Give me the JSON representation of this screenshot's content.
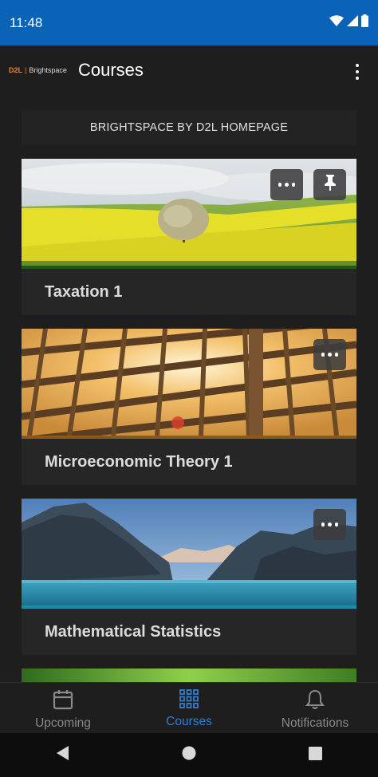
{
  "status_bar": {
    "time": "11:48"
  },
  "app_bar": {
    "logo_brand": "D2L",
    "logo_product": "Brightspace",
    "title": "Courses"
  },
  "homepage_label": "BRIGHTSPACE BY D2L HOMEPAGE",
  "courses": [
    {
      "name": "Taxation 1",
      "pinned": true,
      "stripe_color": "#1f5a10"
    },
    {
      "name": "Microeconomic Theory 1",
      "pinned": false,
      "stripe_color": "#8a5a1a"
    },
    {
      "name": "Mathematical Statistics",
      "pinned": false,
      "stripe_color": "#1a8ea6"
    }
  ],
  "bottom_nav": [
    {
      "label": "Upcoming",
      "icon": "calendar-icon",
      "active": false
    },
    {
      "label": "Courses",
      "icon": "grid-icon",
      "active": true
    },
    {
      "label": "Notifications",
      "icon": "bell-icon",
      "active": false
    }
  ],
  "colors": {
    "status_bar": "#0b63b7",
    "background": "#1e1e1f",
    "accent": "#2d7fd3",
    "brand_orange": "#e8842c"
  }
}
